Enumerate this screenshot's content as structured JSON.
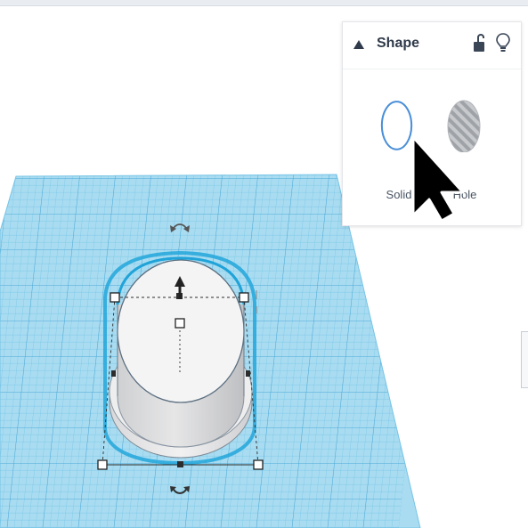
{
  "inspector": {
    "title": "Shape",
    "options": [
      {
        "label": "Solid",
        "selected": true
      },
      {
        "label": "Hole",
        "selected": false
      }
    ]
  },
  "colors": {
    "workplane": "#9fd6ee",
    "grid_line": "#5fb3dc",
    "selection_outline": "#23a5d9",
    "solid_ring": "#4a8fd8",
    "panel_text": "#2f3a4a"
  },
  "icons": {
    "collapse": "triangle-up-icon",
    "lock": "unlock-icon",
    "light": "lightbulb-icon",
    "cursor": "mouse-pointer-icon"
  }
}
